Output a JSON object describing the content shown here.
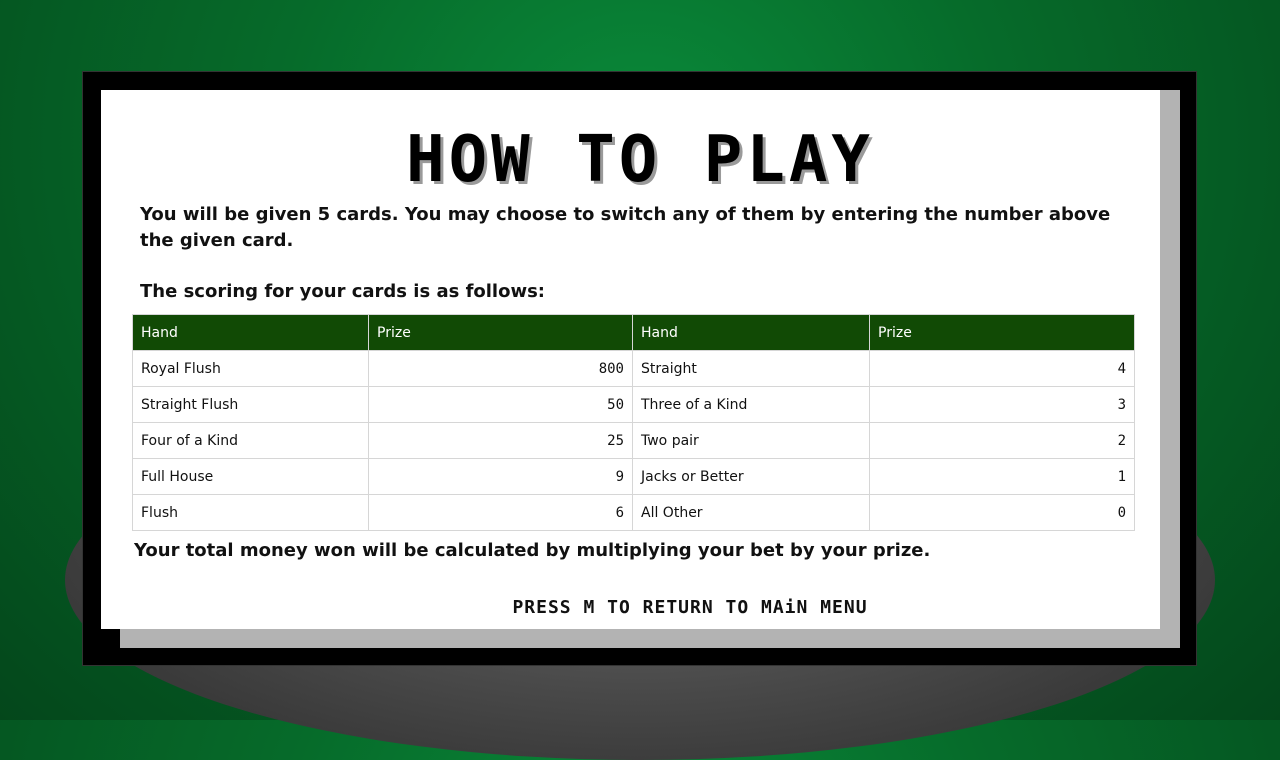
{
  "title": "HOW TO PLAY",
  "intro": "You will be given 5 cards. You may choose to switch any of them by entering the number above the given card.",
  "scoring_label": "The scoring for your cards is as follows:",
  "table": {
    "headers": [
      "Hand",
      "Prize",
      "Hand",
      "Prize"
    ],
    "rows": [
      [
        "Royal Flush",
        "800",
        "Straight",
        "4"
      ],
      [
        "Straight Flush",
        "50",
        "Three of a Kind",
        "3"
      ],
      [
        "Four of a Kind",
        "25",
        "Two pair",
        "2"
      ],
      [
        "Full House",
        "9",
        "Jacks or Better",
        "1"
      ],
      [
        "Flush",
        "6",
        "All Other",
        "0"
      ]
    ]
  },
  "footer_note": "Your total money won will be calculated by multiplying your bet by your prize.",
  "press_hint": "PRESS M TO RETURN TO MAiN MENU",
  "colors": {
    "header_bg": "#114a05",
    "felt": "#066b2a"
  }
}
